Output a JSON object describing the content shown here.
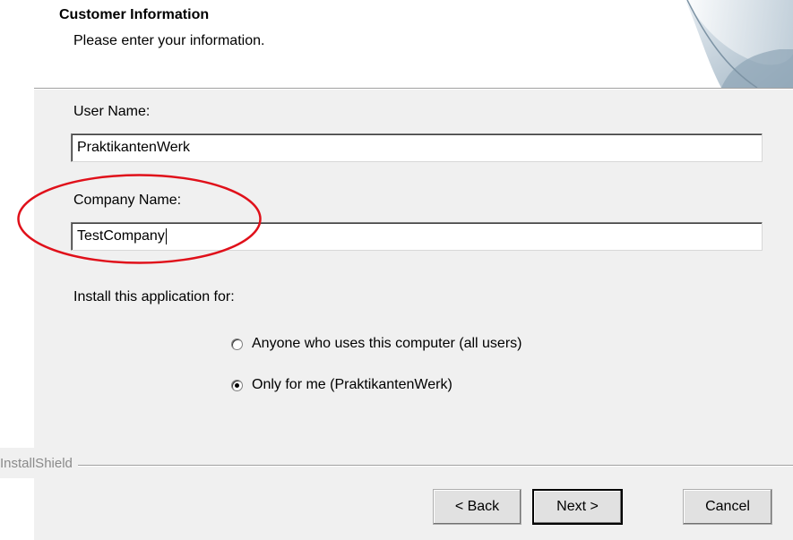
{
  "header": {
    "title": "Customer Information",
    "subtitle": "Please enter your information."
  },
  "form": {
    "user_name_label": "User Name:",
    "user_name_value": "PraktikantenWerk",
    "company_name_label": "Company Name:",
    "company_name_value": "TestCompany",
    "install_for_label": "Install this application for:",
    "options": [
      {
        "label": "Anyone who uses this computer (all users)",
        "selected": false
      },
      {
        "label": "Only for me (PraktikantenWerk)",
        "selected": true
      }
    ]
  },
  "footer": {
    "brand": "InstallShield",
    "back_label": "< Back",
    "next_label": "Next >",
    "cancel_label": "Cancel"
  },
  "colors": {
    "panel_bg": "#f0f0f0",
    "annotation_ring": "#e0101a"
  }
}
